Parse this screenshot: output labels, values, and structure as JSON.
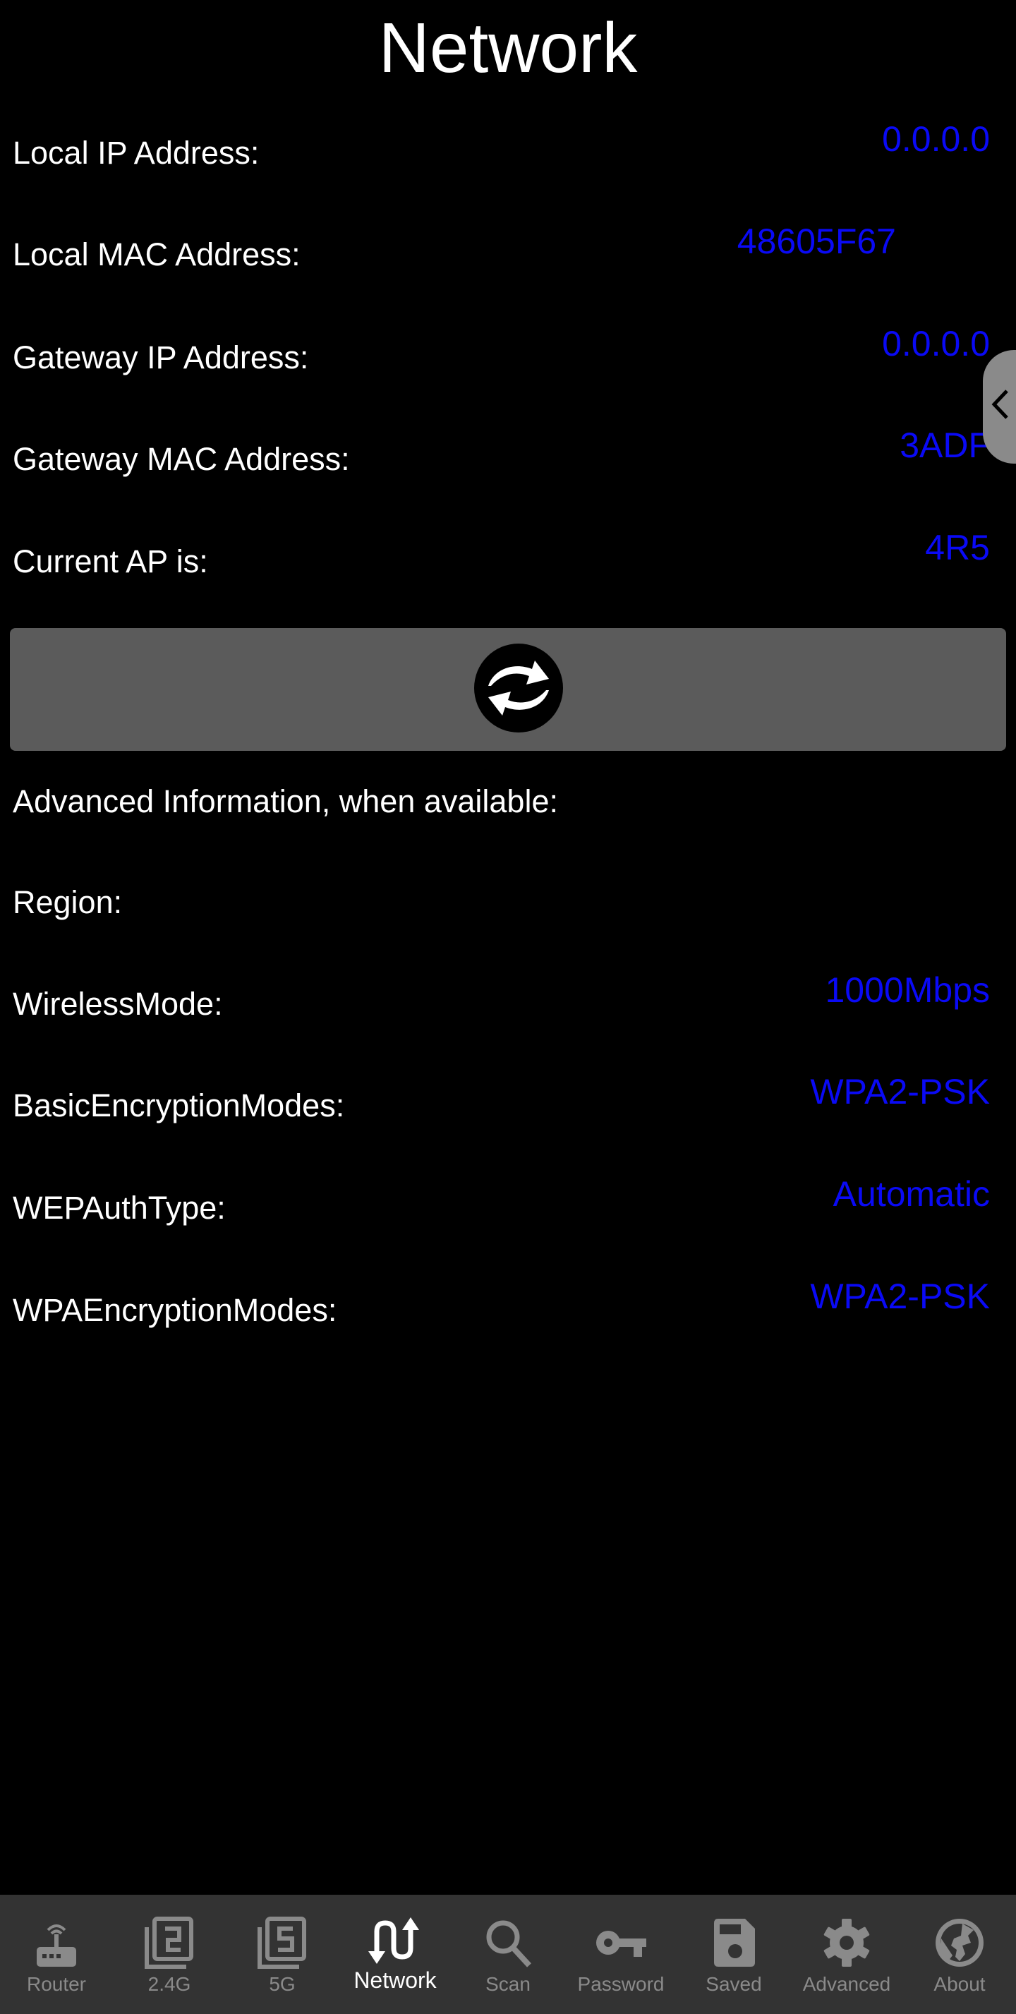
{
  "header": {
    "title": "Network"
  },
  "network_info": [
    {
      "label": "Local IP Address:",
      "value": "0.0.0.0"
    },
    {
      "label": "Local MAC Address:",
      "value": "48605F67"
    },
    {
      "label": "Gateway IP Address:",
      "value": "0.0.0.0"
    },
    {
      "label": "Gateway MAC Address:",
      "value": "3ADF"
    },
    {
      "label": "Current AP is:",
      "value": "4R5"
    }
  ],
  "refresh_button": {
    "icon": "refresh-icon"
  },
  "advanced": {
    "heading": "Advanced Information, when available:",
    "items": [
      {
        "label": "Region:",
        "value": ""
      },
      {
        "label": "WirelessMode:",
        "value": "1000Mbps"
      },
      {
        "label": "BasicEncryptionModes:",
        "value": "WPA2-PSK"
      },
      {
        "label": "WEPAuthType:",
        "value": "Automatic"
      },
      {
        "label": "WPAEncryptionModes:",
        "value": "WPA2-PSK"
      }
    ]
  },
  "side_handle": {
    "icon": "chevron-left-icon"
  },
  "bottom_nav": {
    "active": "Network",
    "items": [
      {
        "label": "Router",
        "icon": "router-icon"
      },
      {
        "label": "2.4G",
        "icon": "filter-2-icon"
      },
      {
        "label": "5G",
        "icon": "filter-5-icon"
      },
      {
        "label": "Network",
        "icon": "swap-calls-icon"
      },
      {
        "label": "Scan",
        "icon": "search-icon"
      },
      {
        "label": "Password",
        "icon": "key-icon"
      },
      {
        "label": "Saved",
        "icon": "save-icon"
      },
      {
        "label": "Advanced",
        "icon": "gear-icon"
      },
      {
        "label": "About",
        "icon": "globe-icon"
      }
    ]
  },
  "colors": {
    "value_text": "#0a0af5",
    "nav_bg": "#333333",
    "nav_inactive": "#8a8a8a",
    "button_bg": "#5b5b5b"
  }
}
